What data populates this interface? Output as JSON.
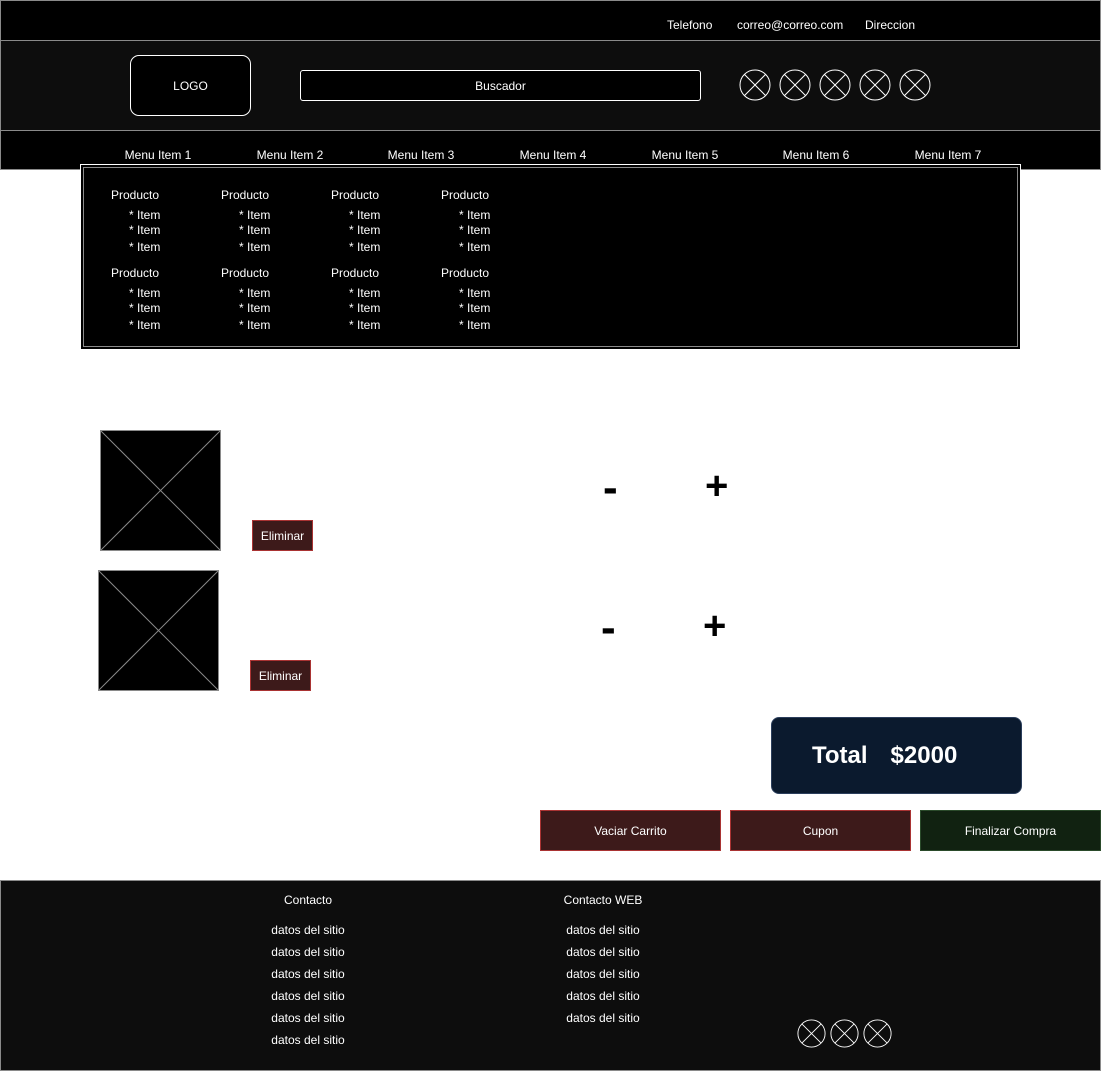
{
  "topbar": {
    "phone": "Telefono",
    "email": "correo@correo.com",
    "address": "Direccion"
  },
  "header": {
    "logo": "LOGO",
    "search_placeholder": "Buscador",
    "social_icons": [
      "placeholder-icon",
      "placeholder-icon",
      "placeholder-icon",
      "placeholder-icon",
      "placeholder-icon"
    ]
  },
  "menu": {
    "items": [
      "Menu Item 1",
      "Menu Item 2",
      "Menu Item 3",
      "Menu Item 4",
      "Menu Item 5",
      "Menu Item 6",
      "Menu Item 7"
    ]
  },
  "dropdown": {
    "product_label": "Producto",
    "item_label": "* Item"
  },
  "cart": {
    "remove_label": "Eliminar",
    "minus": "-",
    "plus": "+",
    "total_label": "Total",
    "total_value": "$2000"
  },
  "actions": {
    "empty_cart": "Vaciar Carrito",
    "coupon": "Cupon",
    "checkout": "Finalizar Compra"
  },
  "footer": {
    "contact_title": "Contacto",
    "web_title": "Contacto WEB",
    "site_data": "datos del sitio",
    "social_icons": [
      "placeholder-icon",
      "placeholder-icon",
      "placeholder-icon"
    ]
  },
  "colors": {
    "dark": "#000000",
    "header_bg": "#0d0d0d",
    "danger": "#3d1a1a",
    "success": "#112211",
    "total_bg": "#0b1a2e"
  }
}
